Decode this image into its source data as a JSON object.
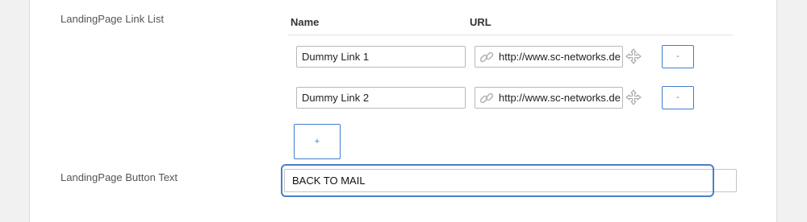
{
  "link_list": {
    "label": "LandingPage Link List",
    "columns": {
      "name": "Name",
      "url": "URL"
    },
    "rows": [
      {
        "name": "Dummy Link 1",
        "url": "http://www.sc-networks.de",
        "remove_label": "-"
      },
      {
        "name": "Dummy Link 2",
        "url": "http://www.sc-networks.de",
        "remove_label": "-"
      }
    ],
    "add_label": "+"
  },
  "button_text": {
    "label": "LandingPage Button Text",
    "value": "BACK TO MAIL"
  },
  "colors": {
    "accent": "#3f7fd1",
    "focus_ring": "#4a7fc9",
    "page_bg": "#f1f1f1"
  },
  "icons": {
    "url_field": "link-icon",
    "row_handle": "move-icon"
  }
}
